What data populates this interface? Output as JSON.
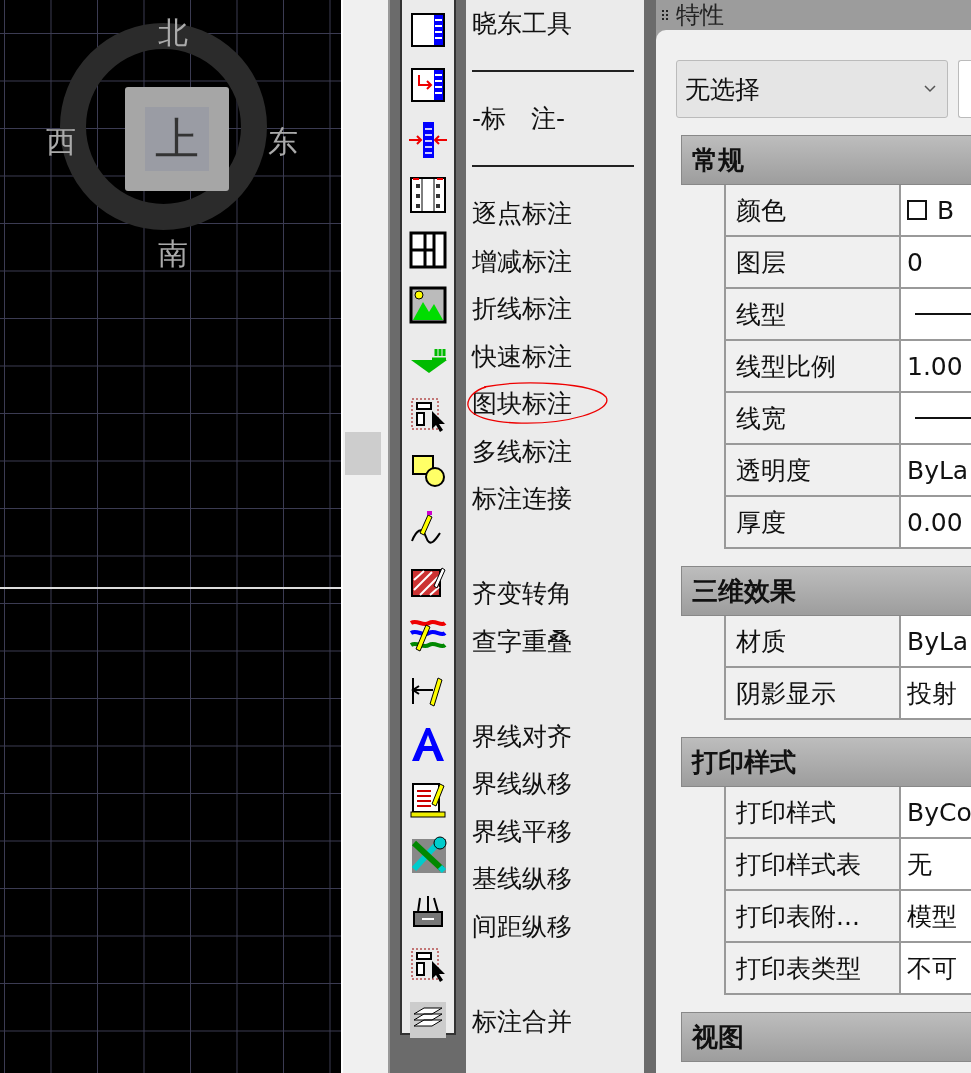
{
  "viewcube": {
    "north": "北",
    "south": "南",
    "west": "西",
    "east": "东",
    "face": "上"
  },
  "toolbar": {
    "icons": [
      {
        "kind": "panel"
      },
      {
        "kind": "panel-arrow"
      },
      {
        "kind": "squeeze"
      },
      {
        "kind": "grid"
      },
      {
        "kind": "columns"
      },
      {
        "kind": "picture"
      },
      {
        "kind": "level"
      },
      {
        "kind": "block-cursor"
      },
      {
        "kind": "shapes"
      },
      {
        "kind": "pen-curve"
      },
      {
        "kind": "hatch"
      },
      {
        "kind": "colors"
      },
      {
        "kind": "dimension"
      },
      {
        "kind": "letter"
      },
      {
        "kind": "document"
      },
      {
        "kind": "tools"
      },
      {
        "kind": "toolbox"
      },
      {
        "kind": "block-cursor"
      },
      {
        "kind": "layers"
      }
    ]
  },
  "menu": [
    {
      "kind": "text",
      "label": "晓东工具",
      "circled": false
    },
    {
      "kind": "rule"
    },
    {
      "kind": "text",
      "label": "-标　注-",
      "circled": false
    },
    {
      "kind": "rule"
    },
    {
      "kind": "text",
      "label": "逐点标注",
      "circled": false
    },
    {
      "kind": "text",
      "label": "增减标注",
      "circled": false
    },
    {
      "kind": "text",
      "label": "折线标注",
      "circled": false
    },
    {
      "kind": "text",
      "label": "快速标注",
      "circled": false
    },
    {
      "kind": "text",
      "label": "图块标注",
      "circled": true
    },
    {
      "kind": "text",
      "label": "多线标注",
      "circled": false
    },
    {
      "kind": "text",
      "label": "标注连接",
      "circled": false
    },
    {
      "kind": "blank"
    },
    {
      "kind": "text",
      "label": "齐变转角",
      "circled": false
    },
    {
      "kind": "text",
      "label": "查字重叠",
      "circled": false
    },
    {
      "kind": "blank"
    },
    {
      "kind": "text",
      "label": "界线对齐",
      "circled": false
    },
    {
      "kind": "text",
      "label": "界线纵移",
      "circled": false
    },
    {
      "kind": "text",
      "label": "界线平移",
      "circled": false
    },
    {
      "kind": "text",
      "label": "基线纵移",
      "circled": false
    },
    {
      "kind": "text",
      "label": "间距纵移",
      "circled": false
    },
    {
      "kind": "blank"
    },
    {
      "kind": "text",
      "label": "标注合并",
      "circled": false
    }
  ],
  "properties": {
    "title": "特性",
    "selection": "无选择",
    "sections": [
      {
        "title": "常规",
        "rows": [
          {
            "label": "颜色",
            "kind": "swatch",
            "value": "B"
          },
          {
            "label": "图层",
            "kind": "text",
            "value": "0"
          },
          {
            "label": "线型",
            "kind": "line"
          },
          {
            "label": "线型比例",
            "kind": "text",
            "value": "1.00"
          },
          {
            "label": "线宽",
            "kind": "line"
          },
          {
            "label": "透明度",
            "kind": "text",
            "value": "ByLa"
          },
          {
            "label": "厚度",
            "kind": "text",
            "value": "0.00"
          }
        ]
      },
      {
        "title": "三维效果",
        "rows": [
          {
            "label": "材质",
            "kind": "text",
            "value": "ByLa"
          },
          {
            "label": "阴影显示",
            "kind": "text",
            "value": "投射"
          }
        ]
      },
      {
        "title": "打印样式",
        "rows": [
          {
            "label": "打印样式",
            "kind": "text",
            "value": "ByCo"
          },
          {
            "label": "打印样式表",
            "kind": "text",
            "value": "无"
          },
          {
            "label": "打印表附...",
            "kind": "text",
            "value": "模型"
          },
          {
            "label": "打印表类型",
            "kind": "text",
            "value": "不可"
          }
        ]
      },
      {
        "title": "视图"
      }
    ]
  }
}
